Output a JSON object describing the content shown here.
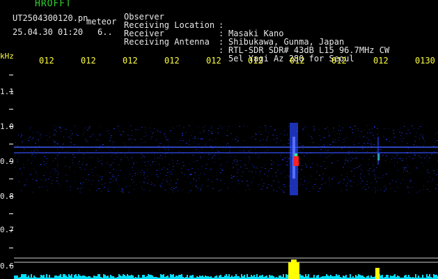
{
  "header": {
    "brand": "HROFFT",
    "filename": "UT2504300120.pn",
    "type_label": "meteor",
    "datetime": "25.04.30 01:20",
    "value": "6.."
  },
  "metadata": [
    {
      "label": "Observer",
      "value": "Masaki Kano"
    },
    {
      "label": "Receiving Location",
      "value": "Shibukawa, Gunma, Japan"
    },
    {
      "label": "Receiver",
      "value": "RTL-SDR SDR# 43dB L15 96.7MHz CW"
    },
    {
      "label": "Receiving Antenna",
      "value": "5el Yagi Az 280 for Seoul"
    }
  ],
  "axes": {
    "y_unit": "kHz",
    "y_labels": [
      "1.1",
      "1.0",
      "0.9",
      "0.8",
      "0.7",
      "0.6"
    ],
    "time_ticks": [
      "012",
      "012",
      "012",
      "012",
      "012",
      "012",
      "012",
      "012",
      "012",
      "0130"
    ]
  },
  "colors": {
    "background": "#000000",
    "header_green": "#2fd02f",
    "tick_yellow": "#ffff40",
    "label_white": "#e8e8e8",
    "noise_blue": "#1e3cff",
    "meteor_red": "#ff2020",
    "meteor_green": "#30ff80",
    "activity_yellow": "#ffff00",
    "baseline_cyan": "#00e0ff"
  }
}
